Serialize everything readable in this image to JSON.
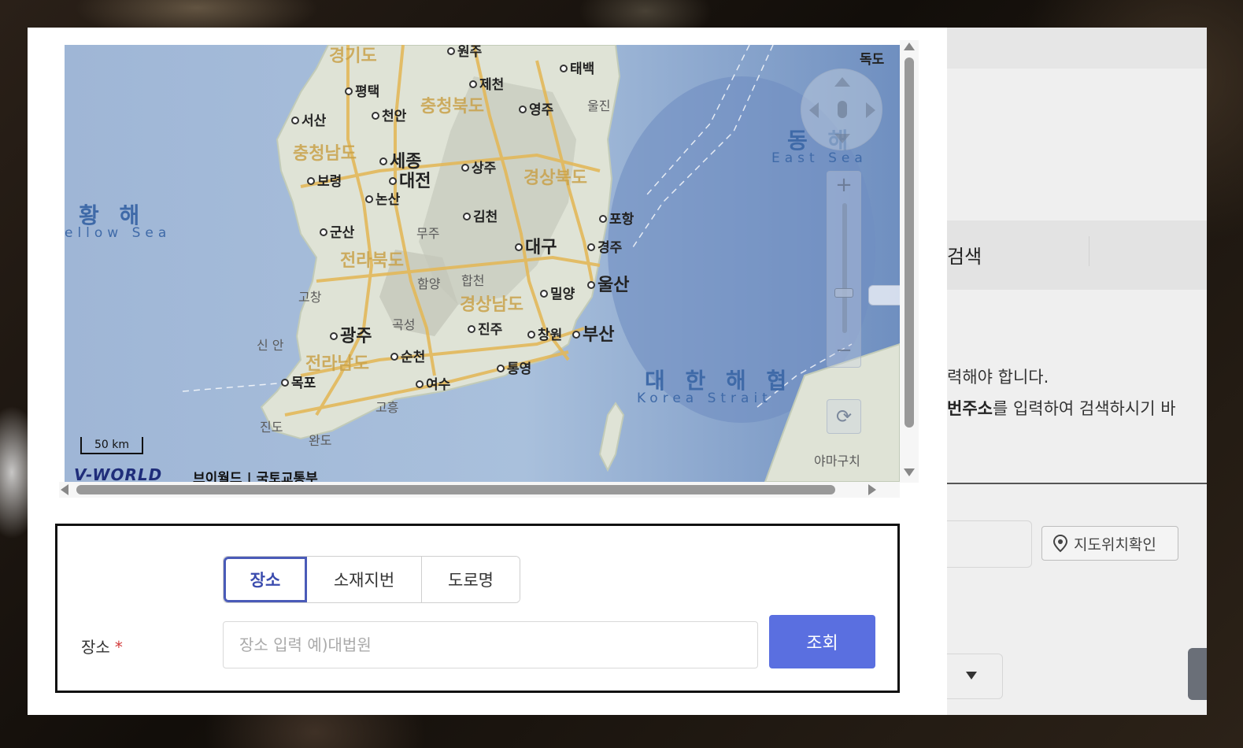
{
  "map": {
    "seas": {
      "yellow_sea_ko": "황 해",
      "yellow_sea_en": "ellow Sea",
      "east_sea_ko": "동 해",
      "east_sea_en": "East Sea",
      "korea_strait_ko": "대 한 해 협",
      "korea_strait_en": "Korea Strait"
    },
    "provinces": {
      "gyeonggi": "경기도",
      "chungbuk": "충청북도",
      "chungnam": "충청남도",
      "gyeongbuk": "경상북도",
      "jeonbuk": "전라북도",
      "gyeongnam": "경상남도",
      "jeonnam": "전라남도"
    },
    "cities": {
      "wonju": "원주",
      "taebaek": "태백",
      "pyeongtaek": "평택",
      "jecheon": "제천",
      "seosan": "서산",
      "cheonan": "천안",
      "yeongju": "영주",
      "uljin": "울진",
      "dokdo": "독도",
      "sejong": "세종",
      "daejeon": "대전",
      "sangju": "상주",
      "boryeong": "보령",
      "nonsan": "논산",
      "gimcheon": "김천",
      "pohang": "포항",
      "gunsan": "군산",
      "muju": "무주",
      "daegu": "대구",
      "gyeongju": "경주",
      "hamyang": "함양",
      "hapcheon": "합천",
      "ulsan": "울산",
      "gochang": "고창",
      "miryang": "밀양",
      "gokseong": "곡성",
      "jinju": "진주",
      "gwangju": "광주",
      "changwon": "창원",
      "busan": "부산",
      "sinan": "신 안",
      "suncheon": "순천",
      "mokpo": "목포",
      "yeosu": "여수",
      "tongyeong": "통영",
      "goheung": "고흥",
      "jindo": "진도",
      "wando": "완도",
      "yamaguchi": "야마구치"
    },
    "scale": "50 km",
    "logo": "V-WORLD",
    "attribution": "브이월드 | 국토교통부",
    "zoom_in": "+",
    "zoom_out": "−"
  },
  "search": {
    "tabs": [
      {
        "label": "장소",
        "active": true
      },
      {
        "label": "소재지번",
        "active": false
      },
      {
        "label": "도로명",
        "active": false
      }
    ],
    "field_label": "장소",
    "required_mark": "*",
    "placeholder": "장소 입력 예)대법원",
    "value": "",
    "submit_label": "조회"
  },
  "background_page": {
    "search_heading": "검색",
    "notice_line1": "력해야 합니다.",
    "notice_line2_bold": "번주소",
    "notice_line2_rest": "를 입력하여 검색하시기 바",
    "map_check_button": "지도위치확인"
  },
  "colors": {
    "accent": "#5a6fe0",
    "tab_active_border": "#4a5bb8",
    "required": "#d23c3c"
  }
}
